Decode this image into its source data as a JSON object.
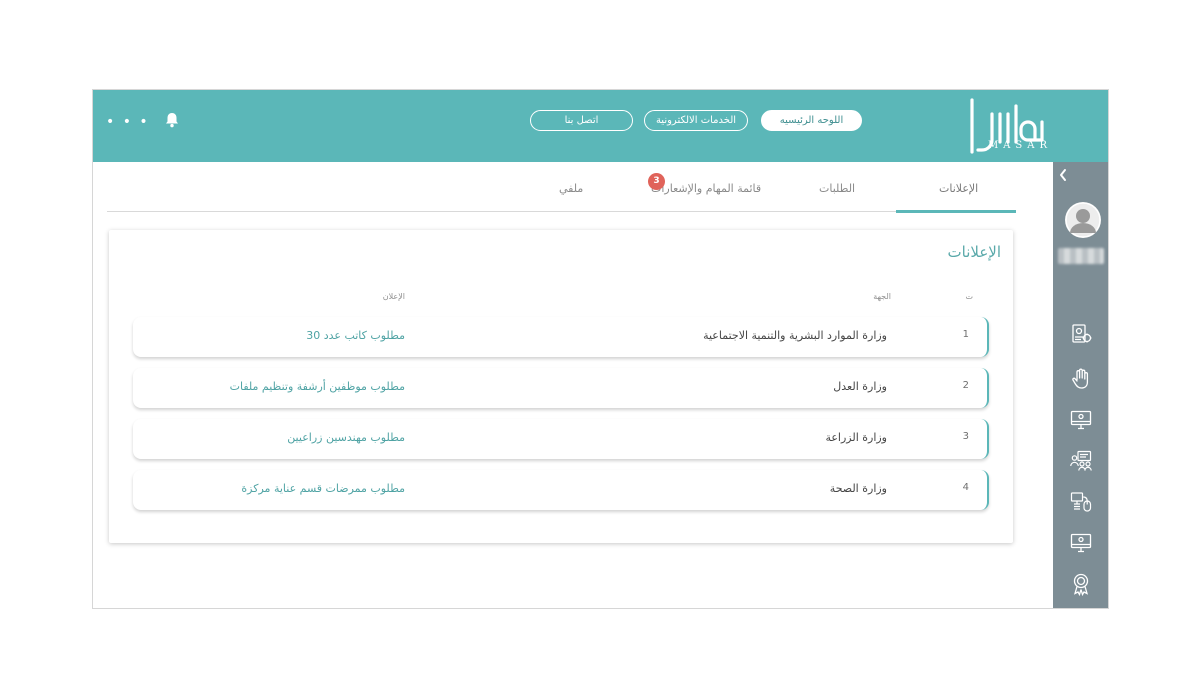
{
  "header": {
    "logo_latin": "MASAR",
    "nav": {
      "home": "اللوحه الرئيسيه",
      "eservices": "الخدمات الالكترونية",
      "contact": "اتصل بنا"
    },
    "more_label": "• • •",
    "icons": {
      "bell": "bell-icon",
      "more": "more-dots-icon"
    }
  },
  "sidebar": {
    "icons": [
      "collapse-chevron-icon",
      "profile-settings-icon",
      "raised-hand-icon",
      "monitor-icon",
      "people-board-icon",
      "computer-mouse-icon",
      "monitor-icon-2",
      "award-badge-icon"
    ]
  },
  "tabs": {
    "items": [
      {
        "id": "announcements",
        "label": "الإعلانات",
        "active": true
      },
      {
        "id": "requests",
        "label": "الطلبات",
        "active": false
      },
      {
        "id": "tasks",
        "label": "قائمة المهام والإشعارات",
        "active": false,
        "badge": "3"
      },
      {
        "id": "profile",
        "label": "ملفي",
        "active": false
      }
    ]
  },
  "card": {
    "title": "الإعلانات",
    "columns": {
      "num": "ت",
      "entity": "الجهة",
      "ad": "الإعلان"
    },
    "rows": [
      {
        "num": "1",
        "entity": "وزارة الموارد البشرية والتنمية الاجتماعية",
        "ad": "مطلوب كاتب عدد 30"
      },
      {
        "num": "2",
        "entity": "وزارة العدل",
        "ad": "مطلوب موظفين أرشفة وتنظيم ملفات"
      },
      {
        "num": "3",
        "entity": "وزارة الزراعة",
        "ad": "مطلوب مهندسين زراعيين"
      },
      {
        "num": "4",
        "entity": "وزارة الصحة",
        "ad": "مطلوب ممرضات قسم عناية مركزة"
      }
    ]
  },
  "colors": {
    "primary": "#5bb7b8",
    "sidebar": "#7d8d95",
    "badge": "#e0635a"
  }
}
